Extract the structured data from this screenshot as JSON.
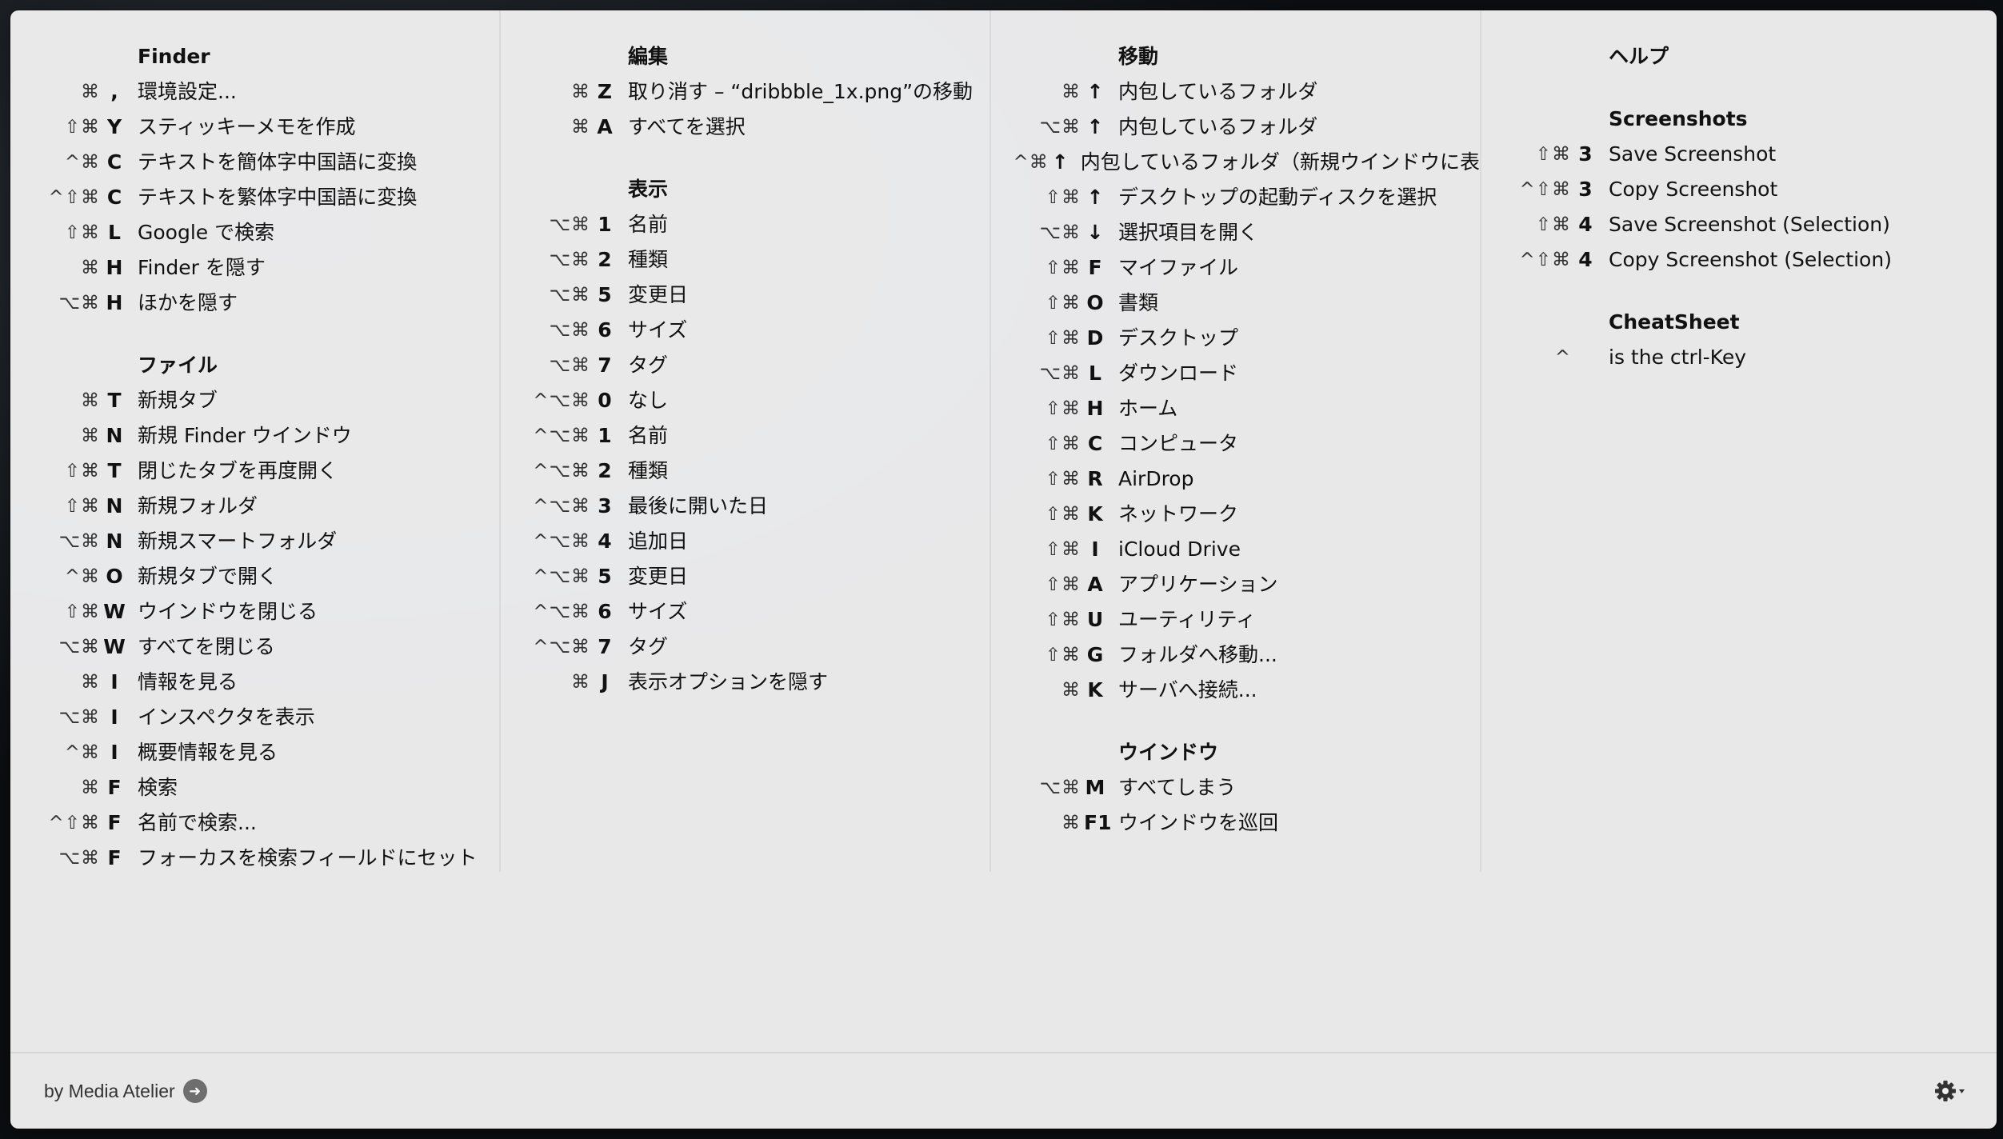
{
  "columns": [
    {
      "sections": [
        {
          "title": "Finder",
          "items": [
            {
              "mods": "⌘",
              "key": ",",
              "label": "環境設定..."
            },
            {
              "mods": "⇧⌘",
              "key": "Y",
              "label": "スティッキーメモを作成"
            },
            {
              "mods": "^⌘",
              "key": "C",
              "label": "テキストを簡体字中国語に変換"
            },
            {
              "mods": "^⇧⌘",
              "key": "C",
              "label": "テキストを繁体字中国語に変換"
            },
            {
              "mods": "⇧⌘",
              "key": "L",
              "label": "Google で検索"
            },
            {
              "mods": "⌘",
              "key": "H",
              "label": "Finder を隠す"
            },
            {
              "mods": "⌥⌘",
              "key": "H",
              "label": "ほかを隠す"
            }
          ]
        },
        {
          "title": "ファイル",
          "items": [
            {
              "mods": "⌘",
              "key": "T",
              "label": "新規タブ"
            },
            {
              "mods": "⌘",
              "key": "N",
              "label": "新規 Finder ウインドウ"
            },
            {
              "mods": "⇧⌘",
              "key": "T",
              "label": "閉じたタブを再度開く"
            },
            {
              "mods": "⇧⌘",
              "key": "N",
              "label": "新規フォルダ"
            },
            {
              "mods": "⌥⌘",
              "key": "N",
              "label": "新規スマートフォルダ"
            },
            {
              "mods": "^⌘",
              "key": "O",
              "label": "新規タブで開く"
            },
            {
              "mods": "⇧⌘",
              "key": "W",
              "label": "ウインドウを閉じる"
            },
            {
              "mods": "⌥⌘",
              "key": "W",
              "label": "すべてを閉じる"
            },
            {
              "mods": "⌘",
              "key": "I",
              "label": "情報を見る"
            },
            {
              "mods": "⌥⌘",
              "key": "I",
              "label": "インスペクタを表示"
            },
            {
              "mods": "^⌘",
              "key": "I",
              "label": "概要情報を見る"
            },
            {
              "mods": "⌘",
              "key": "F",
              "label": "検索"
            },
            {
              "mods": "^⇧⌘",
              "key": "F",
              "label": "名前で検索..."
            },
            {
              "mods": "⌥⌘",
              "key": "F",
              "label": "フォーカスを検索フィールドにセット"
            }
          ]
        }
      ]
    },
    {
      "sections": [
        {
          "title": "編集",
          "items": [
            {
              "mods": "⌘",
              "key": "Z",
              "label": "取り消す – “dribbble_1x.png”の移動"
            },
            {
              "mods": "⌘",
              "key": "A",
              "label": "すべてを選択"
            }
          ]
        },
        {
          "title": "表示",
          "items": [
            {
              "mods": "⌥⌘",
              "key": "1",
              "label": "名前"
            },
            {
              "mods": "⌥⌘",
              "key": "2",
              "label": "種類"
            },
            {
              "mods": "⌥⌘",
              "key": "5",
              "label": "変更日"
            },
            {
              "mods": "⌥⌘",
              "key": "6",
              "label": "サイズ"
            },
            {
              "mods": "⌥⌘",
              "key": "7",
              "label": "タグ"
            },
            {
              "mods": "^⌥⌘",
              "key": "0",
              "label": "なし"
            },
            {
              "mods": "^⌥⌘",
              "key": "1",
              "label": "名前"
            },
            {
              "mods": "^⌥⌘",
              "key": "2",
              "label": "種類"
            },
            {
              "mods": "^⌥⌘",
              "key": "3",
              "label": "最後に開いた日"
            },
            {
              "mods": "^⌥⌘",
              "key": "4",
              "label": "追加日"
            },
            {
              "mods": "^⌥⌘",
              "key": "5",
              "label": "変更日"
            },
            {
              "mods": "^⌥⌘",
              "key": "6",
              "label": "サイズ"
            },
            {
              "mods": "^⌥⌘",
              "key": "7",
              "label": "タグ"
            },
            {
              "mods": "⌘",
              "key": "J",
              "label": "表示オプションを隠す"
            }
          ]
        }
      ]
    },
    {
      "sections": [
        {
          "title": "移動",
          "items": [
            {
              "mods": "⌘",
              "key": "↑",
              "label": "内包しているフォルダ"
            },
            {
              "mods": "⌥⌘",
              "key": "↑",
              "label": "内包しているフォルダ"
            },
            {
              "mods": "^⌘",
              "key": "↑",
              "label": "内包しているフォルダ（新規ウインドウに表"
            },
            {
              "mods": "⇧⌘",
              "key": "↑",
              "label": "デスクトップの起動ディスクを選択"
            },
            {
              "mods": "⌥⌘",
              "key": "↓",
              "label": "選択項目を開く"
            },
            {
              "mods": "⇧⌘",
              "key": "F",
              "label": "マイファイル"
            },
            {
              "mods": "⇧⌘",
              "key": "O",
              "label": "書類"
            },
            {
              "mods": "⇧⌘",
              "key": "D",
              "label": "デスクトップ"
            },
            {
              "mods": "⌥⌘",
              "key": "L",
              "label": "ダウンロード"
            },
            {
              "mods": "⇧⌘",
              "key": "H",
              "label": "ホーム"
            },
            {
              "mods": "⇧⌘",
              "key": "C",
              "label": "コンピュータ"
            },
            {
              "mods": "⇧⌘",
              "key": "R",
              "label": "AirDrop"
            },
            {
              "mods": "⇧⌘",
              "key": "K",
              "label": "ネットワーク"
            },
            {
              "mods": "⇧⌘",
              "key": "I",
              "label": "iCloud Drive"
            },
            {
              "mods": "⇧⌘",
              "key": "A",
              "label": "アプリケーション"
            },
            {
              "mods": "⇧⌘",
              "key": "U",
              "label": "ユーティリティ"
            },
            {
              "mods": "⇧⌘",
              "key": "G",
              "label": "フォルダへ移動..."
            },
            {
              "mods": "⌘",
              "key": "K",
              "label": "サーバへ接続..."
            }
          ]
        },
        {
          "title": "ウインドウ",
          "items": [
            {
              "mods": "⌥⌘",
              "key": "M",
              "label": "すべてしまう"
            },
            {
              "mods": "⌘",
              "key": "F1",
              "label": "ウインドウを巡回"
            }
          ]
        }
      ]
    },
    {
      "sections": [
        {
          "title": "ヘルプ",
          "items": []
        },
        {
          "title": "Screenshots",
          "items": [
            {
              "mods": "⇧⌘",
              "key": "3",
              "label": "Save Screenshot"
            },
            {
              "mods": "^⇧⌘",
              "key": "3",
              "label": "Copy Screenshot"
            },
            {
              "mods": "⇧⌘",
              "key": "4",
              "label": "Save Screenshot (Selection)"
            },
            {
              "mods": "^⇧⌘",
              "key": "4",
              "label": "Copy Screenshot (Selection)"
            }
          ]
        },
        {
          "title": "CheatSheet",
          "items": [
            {
              "mods": "^",
              "key": "",
              "label": "is the ctrl-Key"
            }
          ]
        }
      ]
    }
  ],
  "footer": {
    "credit": "by Media Atelier",
    "credit_icon": "arrow-right-circle-icon",
    "settings_icon": "gear-icon"
  }
}
